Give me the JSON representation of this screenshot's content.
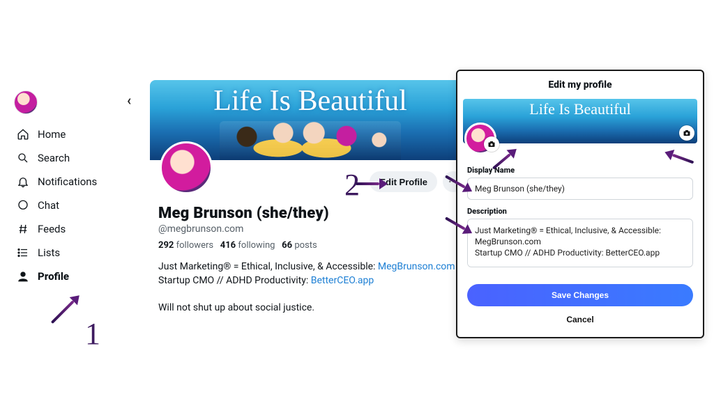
{
  "banner_text": "Life Is Beautiful",
  "sidebar": {
    "items": [
      {
        "label": "Home"
      },
      {
        "label": "Search"
      },
      {
        "label": "Notifications"
      },
      {
        "label": "Chat"
      },
      {
        "label": "Feeds"
      },
      {
        "label": "Lists"
      },
      {
        "label": "Profile"
      }
    ]
  },
  "profile": {
    "edit_label": "Edit Profile",
    "display_name": "Meg Brunson (she/they)",
    "handle": "@megbrunson.com",
    "followers_count": "292",
    "followers_label": "followers",
    "following_count": "416",
    "following_label": "following",
    "posts_count": "66",
    "posts_label": "posts",
    "bio_line1_pre": "Just Marketing® = Ethical, Inclusive, & Accessible: ",
    "bio_line1_link": "MegBrunson.com",
    "bio_line2_pre": "Startup CMO // ADHD Productivity: ",
    "bio_line2_link": "BetterCEO.app",
    "bio_line3": "Will not shut up about social justice."
  },
  "modal": {
    "title": "Edit my profile",
    "display_name_label": "Display Name",
    "display_name_value": "Meg Brunson (she/they)",
    "description_label": "Description",
    "description_value": "Just Marketing® = Ethical, Inclusive, & Accessible: MegBrunson.com\nStartup CMO // ADHD Productivity: BetterCEO.app\n\nWill not shut up about social justice.",
    "save_label": "Save Changes",
    "cancel_label": "Cancel"
  },
  "annotations": {
    "step1": "1",
    "step2": "2"
  }
}
